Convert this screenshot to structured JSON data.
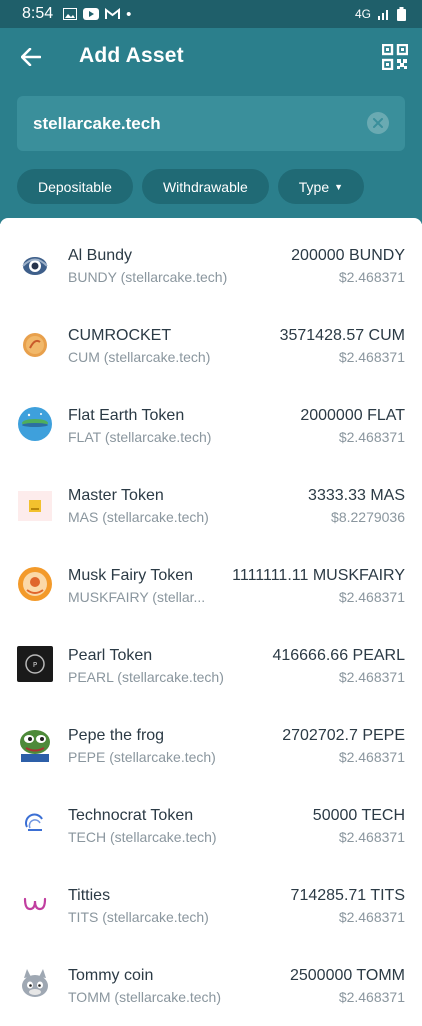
{
  "status_bar": {
    "time": "8:54",
    "dot": "•",
    "network": "4G"
  },
  "header": {
    "title": "Add Asset",
    "back_icon": "arrow-left-icon",
    "qr_icon": "qr-code-icon"
  },
  "search": {
    "value": "stellarcake.tech",
    "clear_icon": "clear-circle-icon"
  },
  "filters": [
    {
      "label": "Depositable"
    },
    {
      "label": "Withdrawable"
    },
    {
      "label": "Type",
      "icon": "caret-down-icon"
    }
  ],
  "assets": [
    {
      "name": "Al Bundy",
      "code": "BUNDY (stellarcake.tech)",
      "amount": "200000 BUNDY",
      "price": "$2.468371",
      "icon": "al-bundy-logo"
    },
    {
      "name": "CUMROCKET",
      "code": "CUM (stellarcake.tech)",
      "amount": "3571428.57 CUM",
      "price": "$2.468371",
      "icon": "cumrocket-logo"
    },
    {
      "name": "Flat Earth Token",
      "code": "FLAT (stellarcake.tech)",
      "amount": "2000000 FLAT",
      "price": "$2.468371",
      "icon": "flat-earth-logo"
    },
    {
      "name": "Master Token",
      "code": "MAS (stellarcake.tech)",
      "amount": "3333.33 MAS",
      "price": "$8.2279036",
      "icon": "master-token-logo"
    },
    {
      "name": "Musk Fairy Token",
      "code": "MUSKFAIRY (stellar...",
      "amount": "1111111.11 MUSKFAIRY",
      "price": "$2.468371",
      "icon": "musk-fairy-logo"
    },
    {
      "name": "Pearl Token",
      "code": "PEARL (stellarcake.tech)",
      "amount": "416666.66 PEARL",
      "price": "$2.468371",
      "icon": "pearl-token-logo"
    },
    {
      "name": "Pepe the frog",
      "code": "PEPE (stellarcake.tech)",
      "amount": "2702702.7 PEPE",
      "price": "$2.468371",
      "icon": "pepe-frog-logo"
    },
    {
      "name": "Technocrat Token",
      "code": "TECH (stellarcake.tech)",
      "amount": "50000 TECH",
      "price": "$2.468371",
      "icon": "technocrat-logo"
    },
    {
      "name": "Titties",
      "code": "TITS (stellarcake.tech)",
      "amount": "714285.71 TITS",
      "price": "$2.468371",
      "icon": "titties-logo"
    },
    {
      "name": "Tommy coin",
      "code": "TOMM (stellarcake.tech)",
      "amount": "2500000 TOMM",
      "price": "$2.468371",
      "icon": "tommy-coin-logo"
    }
  ],
  "colors": {
    "header": "#2b7f8c",
    "status_bar": "#1f5f6a",
    "search_bg": "#3a8f9b",
    "chip_bg": "#206a75"
  }
}
